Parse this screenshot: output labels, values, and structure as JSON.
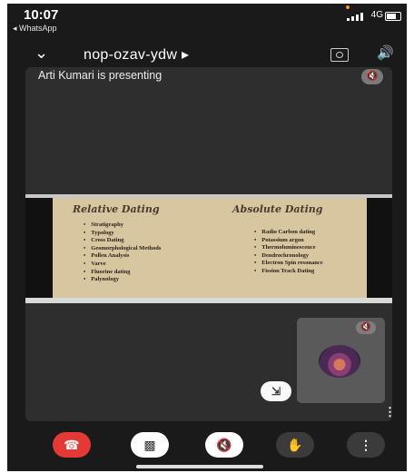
{
  "status": {
    "time": "10:07",
    "back_app": "◂ WhatsApp",
    "network": "4G"
  },
  "meeting": {
    "code": "nop-ozav-ydw ▸"
  },
  "stage": {
    "presenting_text": "Arti Kumari is presenting"
  },
  "slide": {
    "left_title": "Relative Dating",
    "right_title": "Absolute Dating",
    "left_items": [
      "Stratigraphy",
      "Typology",
      "Cross Dating",
      "Geomorphological Methods",
      "Pollen Analysis",
      "Varve",
      "Fluorine dating",
      "Palynology"
    ],
    "right_items": [
      "Radio Carbon dating",
      "Potassium argon",
      "Thermoluminescence",
      "Dendrochronology",
      "Electron Spin resonance",
      "Fission Track Dating"
    ]
  },
  "colors": {
    "end_call": "#e53935",
    "slide_bg": "#d8c6a1"
  },
  "icons": {
    "chevron": "chevron-down-icon",
    "camera_switch": "camera-switch-icon",
    "speaker": "speaker-icon",
    "mic_off": "mic-off-icon",
    "unpin": "collapse-icon",
    "end_call": "phone-hangup-icon",
    "camera_off": "camera-off-icon",
    "hand": "raise-hand-icon",
    "more": "more-vert-icon"
  }
}
